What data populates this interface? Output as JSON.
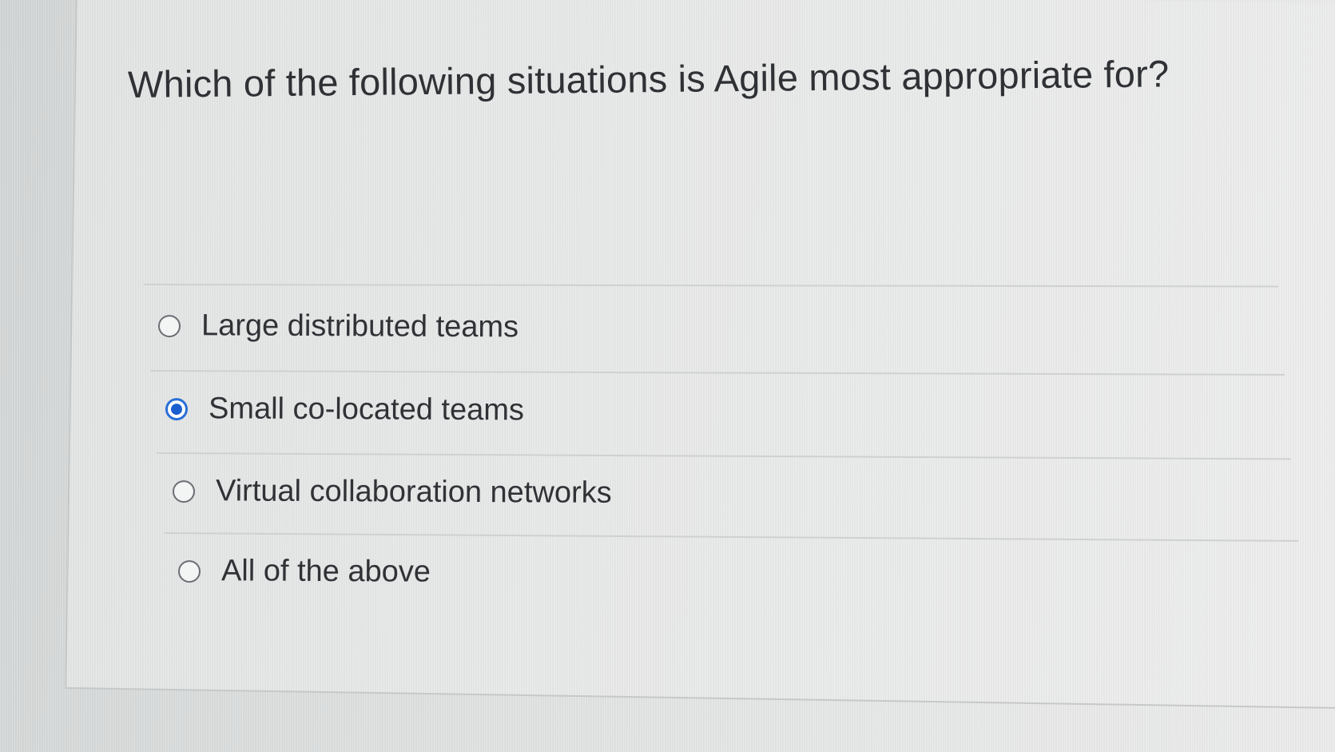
{
  "question": {
    "text": "Which of the following situations is Agile most appropriate for?"
  },
  "options": [
    {
      "label": "Large distributed teams",
      "selected": false
    },
    {
      "label": "Small co-located teams",
      "selected": true
    },
    {
      "label": "Virtual collaboration networks",
      "selected": false
    },
    {
      "label": "All of the above",
      "selected": false
    }
  ],
  "colors": {
    "selected_radio": "#1b5fcf",
    "text": "#303236",
    "background": "#e3e5e5"
  }
}
